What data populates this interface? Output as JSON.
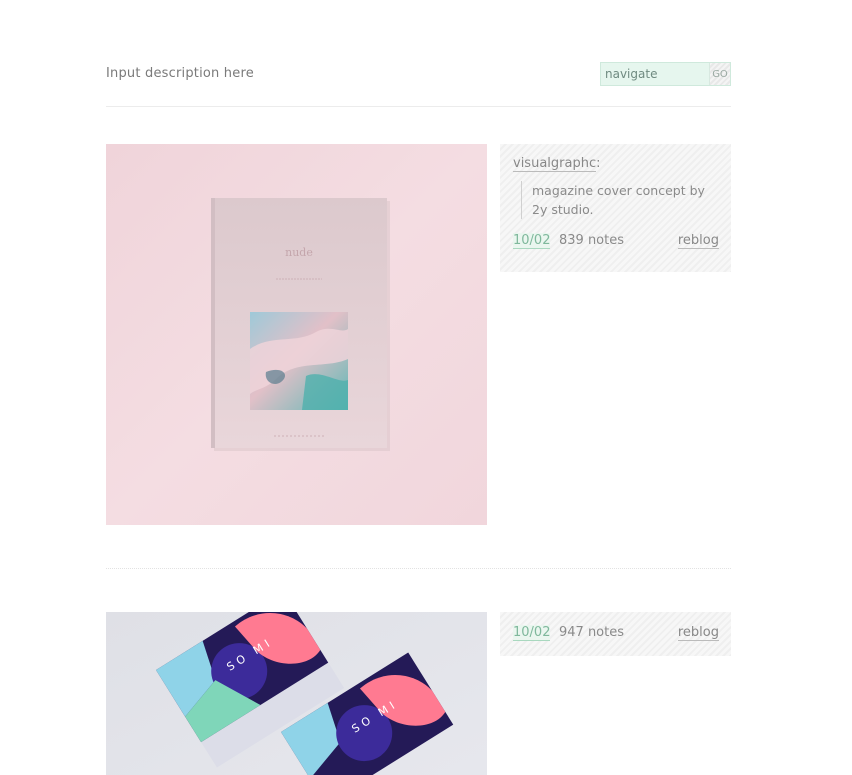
{
  "header": {
    "description": "Input description here",
    "search": {
      "placeholder": "navigate",
      "button_label": "GO"
    }
  },
  "posts": [
    {
      "source": "visualgraphc",
      "caption": "magazine cover concept by 2y studio.",
      "date": "10/02",
      "notes": "839 notes",
      "reblog": "reblog",
      "image": {
        "subject": "magazine cover on pink background",
        "background_color": "#f3d9de",
        "cover_title": "nude"
      }
    },
    {
      "date": "10/02",
      "notes": "947 notes",
      "reblog": "reblog",
      "image": {
        "subject": "business cards with abstract shapes",
        "background_color": "#e3e4ea",
        "card_text": "SO MI"
      }
    }
  ],
  "colors": {
    "accent_green": "#7fb89c",
    "search_bg": "#e6f6ee",
    "post1_bg": "#f3d9de",
    "post2_bg": "#e3e4ea"
  }
}
